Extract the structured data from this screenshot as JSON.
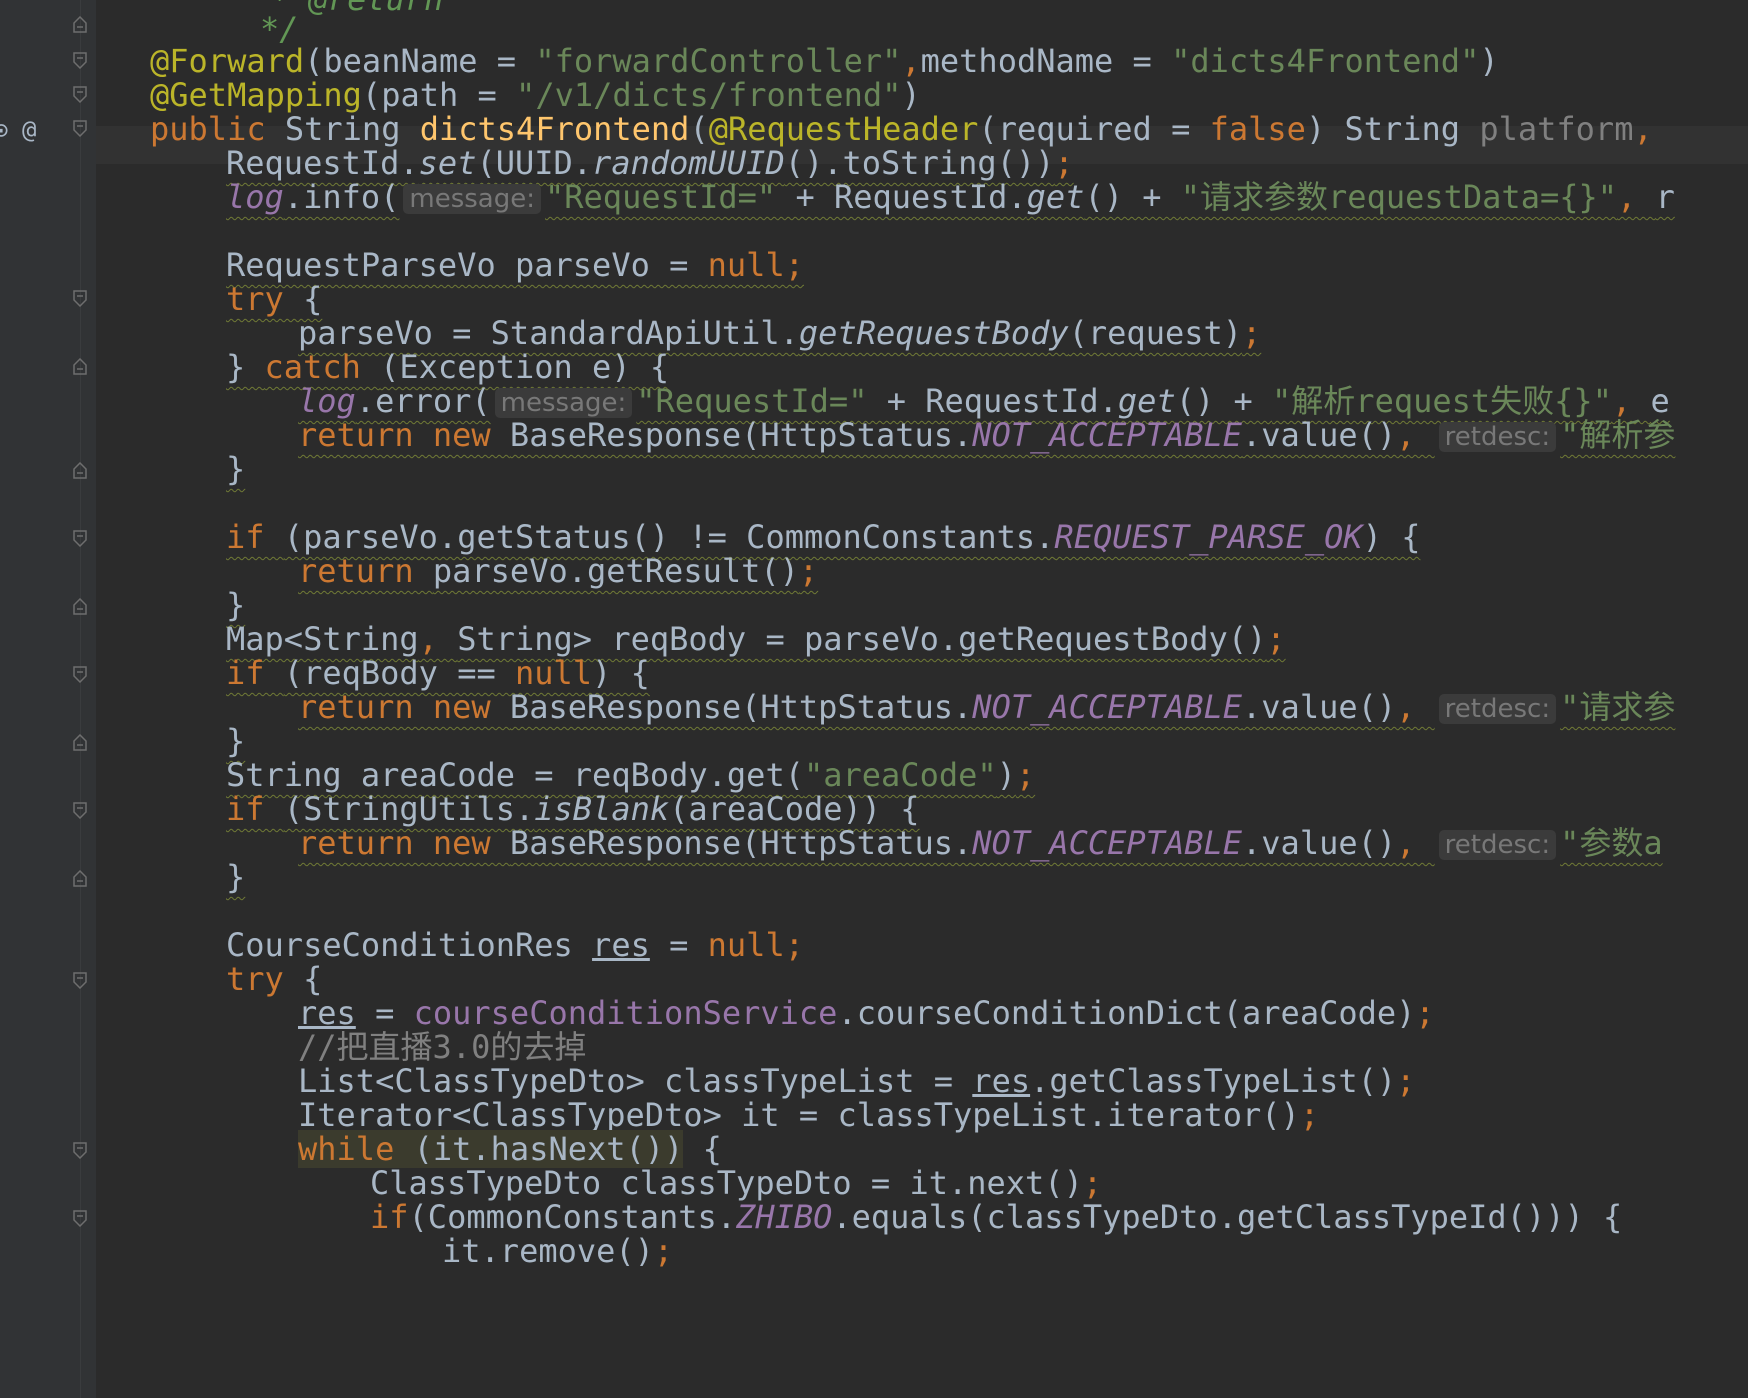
{
  "editor": {
    "language": "java",
    "colors": {
      "background": "#2b2b2b",
      "keyword": "#cc7832",
      "string": "#6a8759",
      "annotation": "#bbb529",
      "field": "#9876aa",
      "method": "#ffc66d",
      "comment": "#808080"
    },
    "lines": [
      {
        "id": "l1",
        "spans": [
          [
            "doc",
            "* @return"
          ]
        ]
      },
      {
        "id": "l2",
        "spans": [
          [
            "doc",
            "*/"
          ]
        ]
      },
      {
        "id": "l3",
        "spans": [
          [
            "ann",
            "@Forward"
          ],
          [
            "p",
            "(beanName = "
          ],
          [
            "str",
            "\"forwardController\""
          ],
          [
            "kw",
            ","
          ],
          [
            "p",
            "methodName = "
          ],
          [
            "str",
            "\"dicts4Frontend\""
          ],
          [
            "p",
            ")"
          ]
        ]
      },
      {
        "id": "l4",
        "spans": [
          [
            "ann",
            "@GetMapping"
          ],
          [
            "p",
            "(path = "
          ],
          [
            "str",
            "\"/v1/dicts/frontend\""
          ],
          [
            "p",
            ")"
          ]
        ]
      },
      {
        "id": "l5",
        "spans": [
          [
            "kw",
            "public "
          ],
          [
            "p",
            "String "
          ],
          [
            "mth",
            "dicts4Frontend"
          ],
          [
            "p",
            "("
          ],
          [
            "ann",
            "@RequestHeader"
          ],
          [
            "p",
            "(required = "
          ],
          [
            "kw",
            "false"
          ],
          [
            "p",
            ") String "
          ],
          [
            "gray",
            "platform"
          ],
          [
            "kw",
            ","
          ]
        ]
      },
      {
        "id": "l6",
        "spans": [
          [
            "p",
            "RequestId."
          ],
          [
            "it",
            "set"
          ],
          [
            "p",
            "(UUID."
          ],
          [
            "it",
            "randomUUID"
          ],
          [
            "p",
            "().toString())"
          ],
          [
            "kw",
            ";"
          ]
        ]
      },
      {
        "id": "l7",
        "spans": [
          [
            "fldit",
            "log"
          ],
          [
            "p",
            ".info("
          ],
          [
            "hint",
            "message:"
          ],
          [
            "str",
            "\"RequestId=\""
          ],
          [
            "p",
            " + RequestId."
          ],
          [
            "it",
            "get"
          ],
          [
            "p",
            "() + "
          ],
          [
            "str",
            "\"请求参数requestData={}\""
          ],
          [
            "kw",
            ", "
          ],
          [
            "p",
            "r"
          ]
        ]
      },
      {
        "id": "l8",
        "spans": []
      },
      {
        "id": "l9",
        "spans": [
          [
            "p",
            "RequestParseVo parseVo = "
          ],
          [
            "kw",
            "null"
          ],
          [
            "kw",
            ";"
          ]
        ]
      },
      {
        "id": "l10",
        "spans": [
          [
            "kw",
            "try "
          ],
          [
            "p",
            "{"
          ]
        ]
      },
      {
        "id": "l11",
        "spans": [
          [
            "p",
            "parseVo = StandardApiUtil."
          ],
          [
            "it",
            "getRequestBody"
          ],
          [
            "p",
            "(request)"
          ],
          [
            "kw",
            ";"
          ]
        ]
      },
      {
        "id": "l12",
        "spans": [
          [
            "p",
            "} "
          ],
          [
            "kw",
            "catch "
          ],
          [
            "p",
            "(Exception e) {"
          ]
        ]
      },
      {
        "id": "l13",
        "spans": [
          [
            "fldit",
            "log"
          ],
          [
            "p",
            ".error("
          ],
          [
            "hint",
            "message:"
          ],
          [
            "str",
            "\"RequestId=\""
          ],
          [
            "p",
            " + RequestId."
          ],
          [
            "it",
            "get"
          ],
          [
            "p",
            "() + "
          ],
          [
            "str",
            "\"解析request失败{}\""
          ],
          [
            "kw",
            ", "
          ],
          [
            "p",
            "e"
          ]
        ]
      },
      {
        "id": "l14",
        "spans": [
          [
            "kw",
            "return new "
          ],
          [
            "p",
            "BaseResponse(HttpStatus."
          ],
          [
            "fldit",
            "NOT_ACCEPTABLE"
          ],
          [
            "p",
            ".value()"
          ],
          [
            "kw",
            ", "
          ],
          [
            "hint",
            "retdesc:"
          ],
          [
            "str",
            "\"解析参"
          ]
        ]
      },
      {
        "id": "l15",
        "spans": [
          [
            "p",
            "}"
          ]
        ]
      },
      {
        "id": "l16",
        "spans": []
      },
      {
        "id": "l17",
        "spans": [
          [
            "kw",
            "if "
          ],
          [
            "p",
            "(parseVo.getStatus() != CommonConstants."
          ],
          [
            "fldit",
            "REQUEST_PARSE_OK"
          ],
          [
            "p",
            ") {"
          ]
        ]
      },
      {
        "id": "l18",
        "spans": [
          [
            "kw",
            "return "
          ],
          [
            "p",
            "parseVo.getResult()"
          ],
          [
            "kw",
            ";"
          ]
        ]
      },
      {
        "id": "l19",
        "spans": [
          [
            "p",
            "}"
          ]
        ]
      },
      {
        "id": "l20",
        "spans": [
          [
            "p",
            "Map<String"
          ],
          [
            "kw",
            ", "
          ],
          [
            "p",
            "String> reqBody = parseVo.getRequestBody()"
          ],
          [
            "kw",
            ";"
          ]
        ]
      },
      {
        "id": "l21",
        "spans": [
          [
            "kw",
            "if "
          ],
          [
            "p",
            "(reqBody == "
          ],
          [
            "kw",
            "null"
          ],
          [
            "p",
            ") {"
          ]
        ]
      },
      {
        "id": "l22",
        "spans": [
          [
            "kw",
            "return new "
          ],
          [
            "p",
            "BaseResponse(HttpStatus."
          ],
          [
            "fldit",
            "NOT_ACCEPTABLE"
          ],
          [
            "p",
            ".value()"
          ],
          [
            "kw",
            ", "
          ],
          [
            "hint",
            "retdesc:"
          ],
          [
            "str",
            "\"请求参"
          ]
        ]
      },
      {
        "id": "l23",
        "spans": [
          [
            "p",
            "}"
          ]
        ]
      },
      {
        "id": "l24",
        "spans": [
          [
            "p",
            "String areaCode = reqBody.get("
          ],
          [
            "str",
            "\"areaCode\""
          ],
          [
            "p",
            ")"
          ],
          [
            "kw",
            ";"
          ]
        ]
      },
      {
        "id": "l25",
        "spans": [
          [
            "kw",
            "if "
          ],
          [
            "p",
            "(StringUtils."
          ],
          [
            "it",
            "isBlank"
          ],
          [
            "p",
            "(areaCode)) {"
          ]
        ]
      },
      {
        "id": "l26",
        "spans": [
          [
            "kw",
            "return new "
          ],
          [
            "p",
            "BaseResponse(HttpStatus."
          ],
          [
            "fldit",
            "NOT_ACCEPTABLE"
          ],
          [
            "p",
            ".value()"
          ],
          [
            "kw",
            ", "
          ],
          [
            "hint",
            "retdesc:"
          ],
          [
            "str",
            "\"参数a"
          ]
        ]
      },
      {
        "id": "l27",
        "spans": [
          [
            "p",
            "}"
          ]
        ]
      },
      {
        "id": "l28",
        "spans": []
      },
      {
        "id": "l29",
        "spans": [
          [
            "p",
            "CourseConditionRes "
          ],
          [
            "ul",
            "res"
          ],
          [
            "p",
            " = "
          ],
          [
            "kw",
            "null"
          ],
          [
            "kw",
            ";"
          ]
        ]
      },
      {
        "id": "l30",
        "spans": [
          [
            "kw",
            "try "
          ],
          [
            "p",
            "{"
          ]
        ]
      },
      {
        "id": "l31",
        "spans": [
          [
            "ul",
            "res"
          ],
          [
            "p",
            " = "
          ],
          [
            "fld",
            "courseConditionService"
          ],
          [
            "p",
            ".courseConditionDict(areaCode)"
          ],
          [
            "kw",
            ";"
          ]
        ]
      },
      {
        "id": "l32",
        "spans": [
          [
            "cmt",
            "//把直播3.0的去掉"
          ]
        ]
      },
      {
        "id": "l33",
        "spans": [
          [
            "p",
            "List<ClassTypeDto> classTypeList = "
          ],
          [
            "ul",
            "res"
          ],
          [
            "p",
            ".getClassTypeList()"
          ],
          [
            "kw",
            ";"
          ]
        ]
      },
      {
        "id": "l34",
        "spans": [
          [
            "p",
            "Iterator<ClassTypeDto> it = classTypeList.iterator()"
          ],
          [
            "kw",
            ";"
          ]
        ]
      },
      {
        "id": "l35",
        "spans": [
          [
            "hlkw",
            "while "
          ],
          [
            "hl",
            "(it.hasNext())"
          ],
          [
            "p",
            " {"
          ]
        ]
      },
      {
        "id": "l36",
        "spans": [
          [
            "p",
            "ClassTypeDto classTypeDto = it.next()"
          ],
          [
            "kw",
            ";"
          ]
        ]
      },
      {
        "id": "l37",
        "spans": [
          [
            "kw",
            "if"
          ],
          [
            "p",
            "(CommonConstants."
          ],
          [
            "fldit",
            "ZHIBO"
          ],
          [
            "p",
            ".equals(classTypeDto.getClassTypeId())) {"
          ]
        ]
      },
      {
        "id": "l38",
        "spans": [
          [
            "p",
            "it.remove()"
          ],
          [
            "kw",
            ";"
          ]
        ]
      }
    ]
  }
}
